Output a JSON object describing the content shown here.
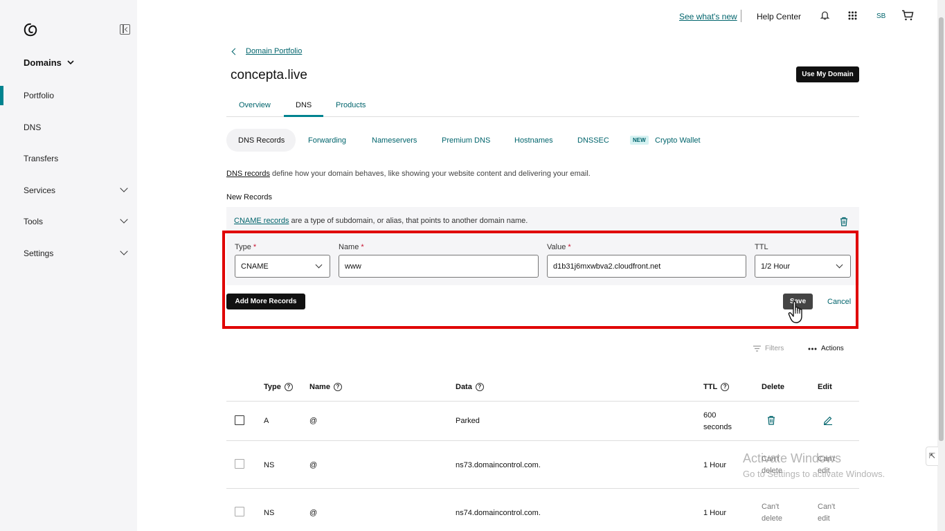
{
  "header": {
    "whats_new": "See what's new",
    "help_center": "Help Center",
    "avatar": "SB"
  },
  "sidebar": {
    "section": "Domains",
    "items": [
      {
        "label": "Portfolio"
      },
      {
        "label": "DNS"
      },
      {
        "label": "Transfers"
      },
      {
        "label": "Services"
      },
      {
        "label": "Tools"
      },
      {
        "label": "Settings"
      }
    ]
  },
  "breadcrumb": "Domain Portfolio",
  "page_title": "concepta.live",
  "use_domain_label": "Use My Domain",
  "tabs": [
    {
      "label": "Overview"
    },
    {
      "label": "DNS"
    },
    {
      "label": "Products"
    }
  ],
  "subtabs": [
    {
      "label": "DNS Records"
    },
    {
      "label": "Forwarding"
    },
    {
      "label": "Nameservers"
    },
    {
      "label": "Premium DNS"
    },
    {
      "label": "Hostnames"
    },
    {
      "label": "DNSSEC"
    },
    {
      "label": "Crypto Wallet",
      "badge": "NEW"
    }
  ],
  "description": {
    "link": "DNS records",
    "text": " define how your domain behaves, like showing your website content and delivering your email."
  },
  "new_records_label": "New Records",
  "cname_info": {
    "link": "CNAME records",
    "text": " are a type of subdomain, or alias, that points to another domain name."
  },
  "form": {
    "type_label": "Type",
    "type_value": "CNAME",
    "name_label": "Name",
    "name_value": "www",
    "value_label": "Value",
    "value_value": "d1b31j6mxwbva2.cloudfront.net",
    "ttl_label": "TTL",
    "ttl_value": "1/2 Hour",
    "required_mark": "*"
  },
  "add_more_label": "Add More Records",
  "save_label": "Save",
  "cancel_label": "Cancel",
  "filters_label": "Filters",
  "actions_label": "Actions",
  "table": {
    "headers": {
      "type": "Type",
      "name": "Name",
      "data": "Data",
      "ttl": "TTL",
      "delete": "Delete",
      "edit": "Edit"
    },
    "rows": [
      {
        "type": "A",
        "name": "@",
        "data": "Parked",
        "ttl": "600 seconds",
        "delete": "",
        "edit": ""
      },
      {
        "type": "NS",
        "name": "@",
        "data": "ns73.domaincontrol.com.",
        "ttl": "1 Hour",
        "delete": "Can't delete",
        "edit": "Can't edit"
      },
      {
        "type": "NS",
        "name": "@",
        "data": "ns74.domaincontrol.com.",
        "ttl": "1 Hour",
        "delete": "Can't delete",
        "edit": "Can't edit"
      }
    ]
  },
  "watermark": {
    "line1": "Activate Windows",
    "line2": "Go to Settings to activate Windows."
  },
  "colors": {
    "accent": "#00838f",
    "link": "#00646c",
    "highlight": "#e00000"
  }
}
